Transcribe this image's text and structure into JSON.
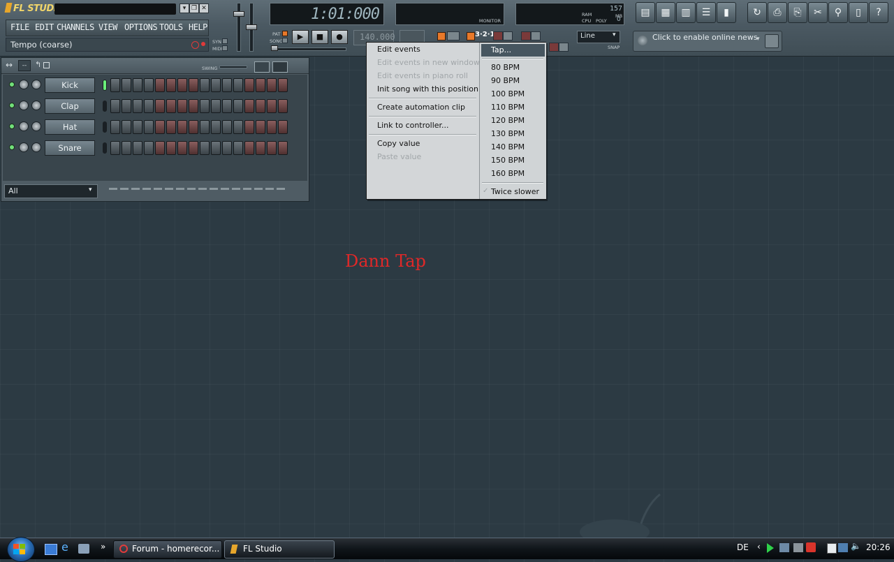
{
  "app": {
    "logo": "FL STUDIO"
  },
  "menu": {
    "items": [
      "FILE",
      "EDIT",
      "CHANNELS",
      "VIEW",
      "OPTIONS",
      "TOOLS",
      "HELP"
    ]
  },
  "hint_bar": {
    "text": "Tempo (coarse)"
  },
  "transport": {
    "time": "1:01:000",
    "pat_label": "PAT",
    "song_label": "SONG",
    "tempo": "140.000",
    "syn_label": "SYN",
    "midi_label": "MIDI",
    "snap_label": "SNAP",
    "snap_value": "Line",
    "monitor_label": "MONITOR",
    "ram_label": "RAM",
    "cpu_label": "CPU",
    "poly_label": "POLY",
    "ram_value": "157",
    "mb_label": "MB",
    "poly_value": "0"
  },
  "news": {
    "text": "Click to enable online news"
  },
  "step_sequencer": {
    "swing_label": "SWING",
    "channels": [
      {
        "name": "Kick"
      },
      {
        "name": "Clap"
      },
      {
        "name": "Hat"
      },
      {
        "name": "Snare"
      }
    ],
    "filter": "All"
  },
  "context_menu": {
    "left_items": [
      {
        "label": "Edit events",
        "enabled": true
      },
      {
        "label": "Edit events in new window",
        "enabled": false
      },
      {
        "label": "Edit events in piano roll",
        "enabled": false
      },
      {
        "label": "Init song with this position",
        "enabled": true
      },
      {
        "label": "Create automation clip",
        "enabled": true
      },
      {
        "label": "Link to controller...",
        "enabled": true
      },
      {
        "label": "Copy value",
        "enabled": true
      },
      {
        "label": "Paste value",
        "enabled": false
      }
    ],
    "tap_label": "Tap...",
    "bpm_items": [
      "80 BPM",
      "90 BPM",
      "100 BPM",
      "110 BPM",
      "120 BPM",
      "130 BPM",
      "140 BPM",
      "150 BPM",
      "160 BPM"
    ],
    "twice_slower": "Twice slower"
  },
  "annotation": {
    "text": "Dann Tap"
  },
  "taskbar": {
    "tasks": [
      {
        "label": "Forum - homerecor..."
      },
      {
        "label": "FL Studio"
      }
    ],
    "language": "DE",
    "time": "20:26",
    "chevron": "»"
  },
  "colors": {
    "background": "#2c3a43",
    "annotation": "#e02828",
    "menu_highlight": "#475660",
    "step_dark": "#4f3030",
    "led_green": "#72e07a"
  }
}
